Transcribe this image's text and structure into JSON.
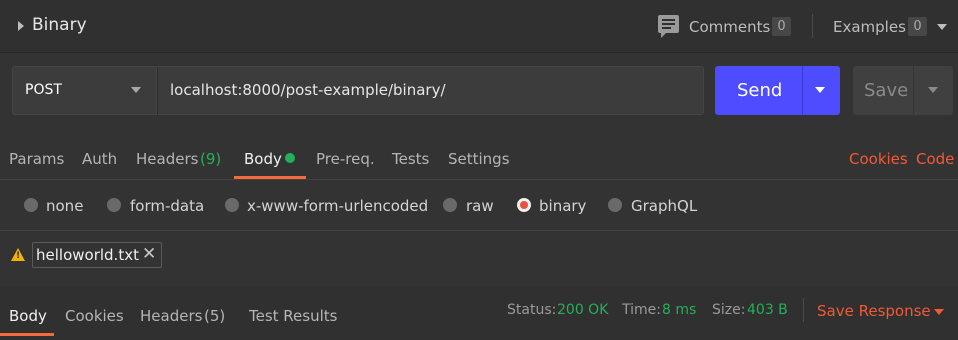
{
  "header": {
    "title": "Binary",
    "comments_label": "Comments",
    "comments_count": "0",
    "examples_label": "Examples",
    "examples_count": "0"
  },
  "request": {
    "method": "POST",
    "url": "localhost:8000/post-example/binary/",
    "send_label": "Send",
    "save_label": "Save"
  },
  "tabs": {
    "params": "Params",
    "auth": "Auth",
    "headers": "Headers",
    "headers_count": "(9)",
    "body": "Body",
    "prereq": "Pre-req.",
    "tests": "Tests",
    "settings": "Settings",
    "cookies_link": "Cookies",
    "code_link": "Code"
  },
  "body_types": {
    "none": "none",
    "form_data": "form-data",
    "urlencoded": "x-www-form-urlencoded",
    "raw": "raw",
    "binary": "binary",
    "graphql": "GraphQL",
    "selected": "binary"
  },
  "file": {
    "name": "helloworld.txt"
  },
  "response": {
    "tabs": {
      "body": "Body",
      "cookies": "Cookies",
      "headers": "Headers",
      "headers_count": "(5)",
      "test_results": "Test Results"
    },
    "status_label": "Status:",
    "status_value": "200 OK",
    "time_label": "Time:",
    "time_value": "8 ms",
    "size_label": "Size:",
    "size_value": "403 B",
    "save_response": "Save Response"
  },
  "colors": {
    "accent_orange": "#f15a35",
    "send_blue": "#4d4dff",
    "success_green": "#24b058",
    "warning_yellow": "#f5b000"
  }
}
